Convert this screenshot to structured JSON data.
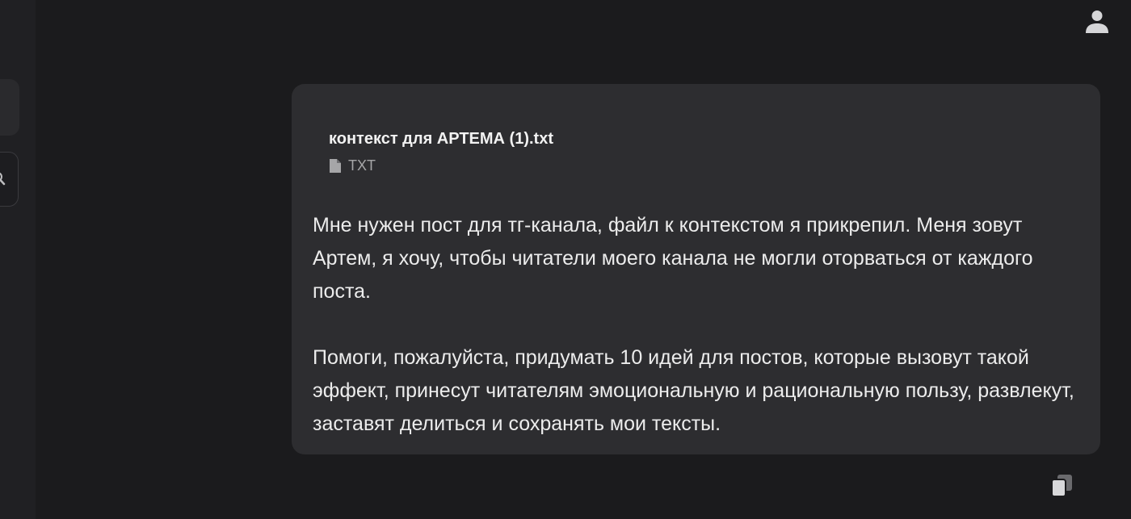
{
  "attachment": {
    "file_name": "контекст для АРТЕМА (1).txt",
    "file_type": "TXT",
    "icon": "document-icon"
  },
  "message": {
    "paragraph_1": "Мне нужен пост для тг-канала, файл к контекстом я прикрепил. Меня зовут Артем, я хочу, чтобы читатели моего канала не могли оторваться от каждого поста.",
    "paragraph_2": "Помоги, пожалуйста, придумать 10 идей для постов, которые вызовут такой эффект, принесут читателям эмоциональную и рациональную пользу, развлекут, заставят делиться и сохранять мои тексты."
  },
  "icons": {
    "avatar": "user-icon",
    "copy": "copy-icon",
    "sidebar_search": "search-icon"
  },
  "colors": {
    "background": "#1b1b1d",
    "sidebar": "#202023",
    "bubble": "#2d2d30",
    "text": "#ececec",
    "muted_text": "#a6a6a8"
  }
}
